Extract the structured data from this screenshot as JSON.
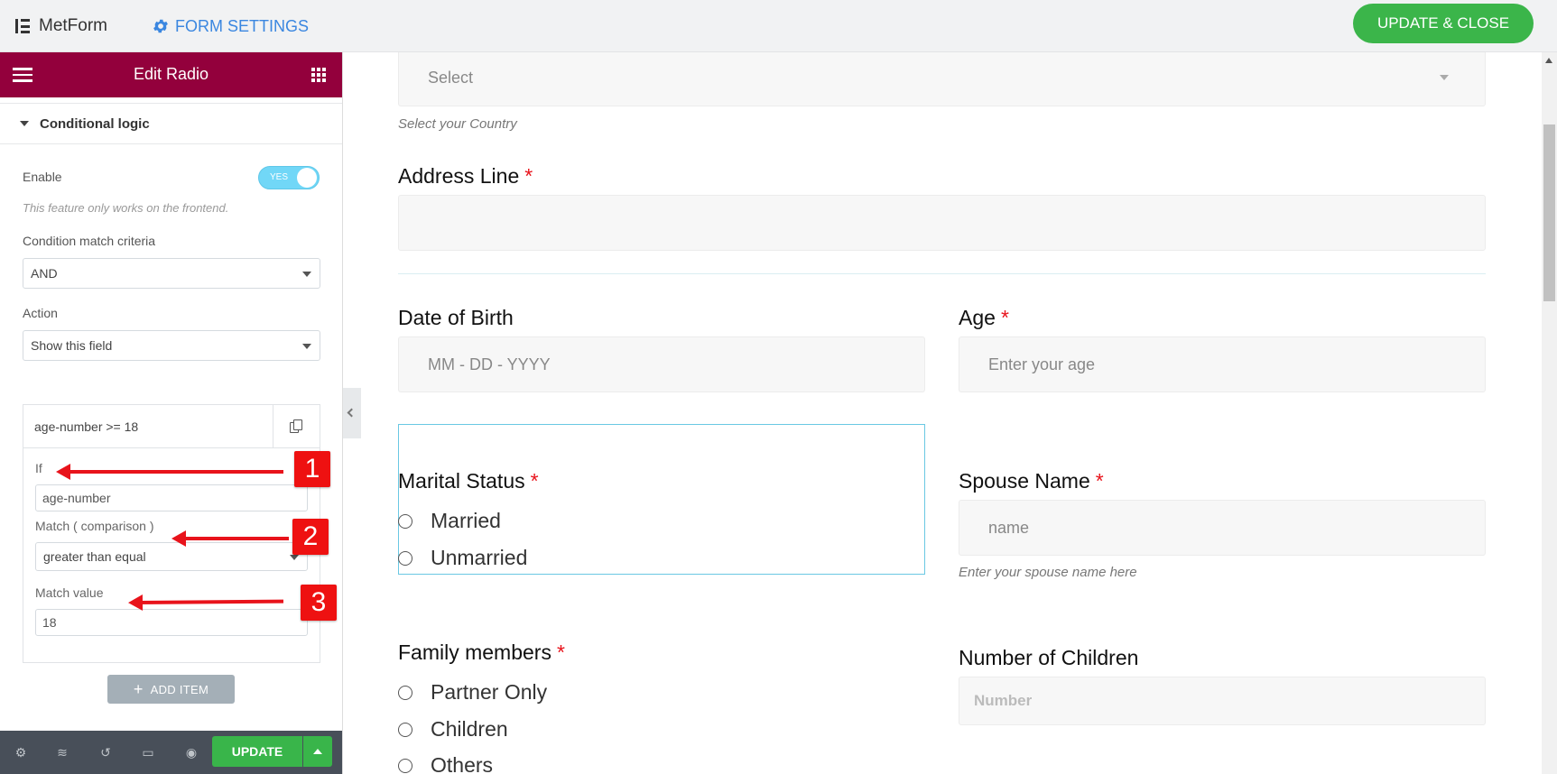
{
  "topbar": {
    "brand": "MetForm",
    "form_settings": "FORM SETTINGS",
    "update_close": "UPDATE & CLOSE",
    "accent": "#3bb54a"
  },
  "panel": {
    "title": "Edit Radio",
    "header_color": "#93003c",
    "section": "Conditional logic",
    "enable_label": "Enable",
    "enable_toggle": "YES",
    "enable_note": "This feature only works on the frontend.",
    "criteria_label": "Condition match criteria",
    "criteria_value": "AND",
    "action_label": "Action",
    "action_value": "Show this field",
    "repeater": {
      "item_title": "age-number >= 18",
      "if_label": "If",
      "if_value": "age-number",
      "match_label": "Match ( comparison )",
      "match_value": "greater than equal",
      "match_value_label": "Match value",
      "match_value_value": "18"
    },
    "add_item": "ADD ITEM",
    "update": "UPDATE"
  },
  "annotations": [
    "1",
    "2",
    "3"
  ],
  "preview": {
    "country_select": "Select",
    "country_help": "Select your Country",
    "address_label": "Address Line",
    "dob_label": "Date of Birth",
    "dob_placeholder": "MM - DD - YYYY",
    "age_label": "Age",
    "age_placeholder": "Enter your age",
    "marital_label": "Marital Status",
    "marital_options": [
      "Married",
      "Unmarried"
    ],
    "spouse_label": "Spouse Name",
    "spouse_placeholder": "name",
    "spouse_help": "Enter your spouse name here",
    "family_label": "Family members",
    "family_options": [
      "Partner Only",
      "Children",
      "Others"
    ],
    "children_label": "Number of Children",
    "children_placeholder": "Number",
    "required_mark": "*"
  }
}
